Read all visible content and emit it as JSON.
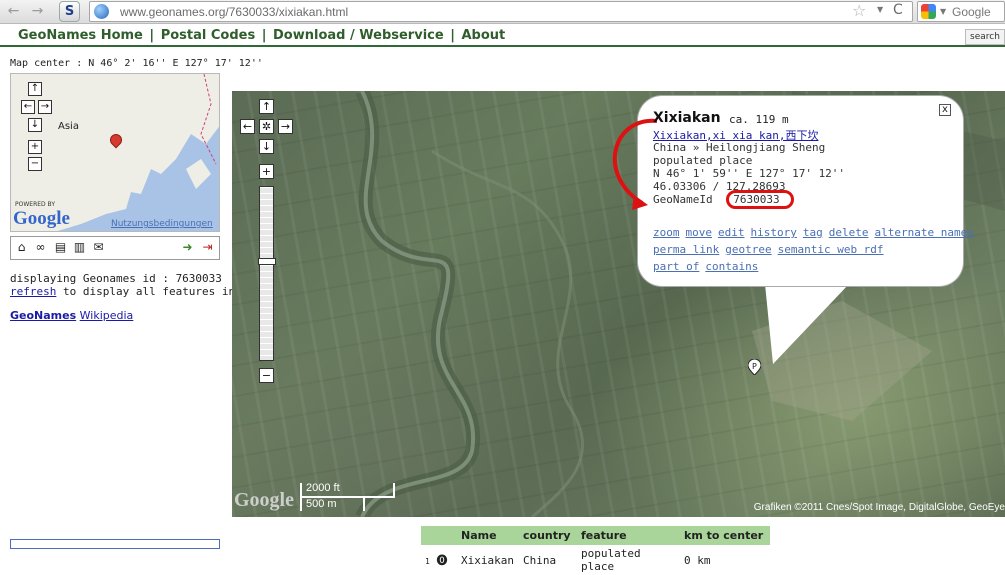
{
  "browser": {
    "url": "www.geonames.org/7630033/xixiakan.html",
    "search_engine": "Google",
    "back": "←",
    "forward": "→",
    "s_button": "S",
    "star": "☆",
    "reload": "C"
  },
  "nav": {
    "items": [
      "GeoNames Home",
      "Postal Codes",
      "Download / Webservice",
      "About"
    ],
    "separators": [
      "|",
      "|",
      "|"
    ],
    "search": "search"
  },
  "left": {
    "map_center": "Map center : N 46° 2' 16'' E 127° 17' 12''",
    "overview_label": "Asia",
    "powered_by": "POWERED BY",
    "google": "Google",
    "terms": "Nutzungsbedingungen",
    "displaying": "displaying Geonames id : 7630033",
    "refresh_link": "refresh",
    "refresh_rest": " to display all features in area",
    "link_geonames": "GeoNames",
    "link_wikipedia": "Wikipedia"
  },
  "map": {
    "scale_ft": "2000 ft",
    "scale_m": "500 m",
    "google": "Google",
    "copyright": "Grafiken ©2011 Cnes/Spot Image, DigitalGlobe, GeoEye",
    "controls": {
      "up": "↑",
      "left": "←",
      "center": "✲",
      "right": "→",
      "down": "↓",
      "zoom_in": "+",
      "zoom_out": "−"
    },
    "zoom_level_fraction": 0.42
  },
  "bubble": {
    "title": "Xixiakan",
    "altitude": "ca. 119 m",
    "alt_names": "Xixiakan,xi xia kan,西下坎",
    "region": "China » Heilongjiang Sheng",
    "feature": "populated place",
    "coords_dms": "N 46° 1' 59'' E 127° 17' 12''",
    "coords_dec": "46.03306 / 127.28693",
    "id_label": "GeoNameId",
    "id_value": "7630033",
    "close": "x",
    "links_row1": [
      "zoom",
      "move",
      "edit",
      "history",
      "tag",
      "delete",
      "alternate names"
    ],
    "links_row2": [
      "perma link",
      "geotree",
      "semantic web rdf"
    ],
    "links_row3": [
      "part of",
      "contains"
    ]
  },
  "table": {
    "headers": [
      "",
      "Name",
      "country",
      "feature",
      "km to center"
    ],
    "rows": [
      {
        "num": "1",
        "name": "Xixiakan",
        "country": "China",
        "feature": "populated place",
        "km": "0 km"
      }
    ]
  },
  "colors": {
    "nav_green": "#2f5e2c",
    "table_header": "#a9d59a",
    "annotation_red": "#dd1111",
    "link_blue": "#4a6fb5"
  }
}
